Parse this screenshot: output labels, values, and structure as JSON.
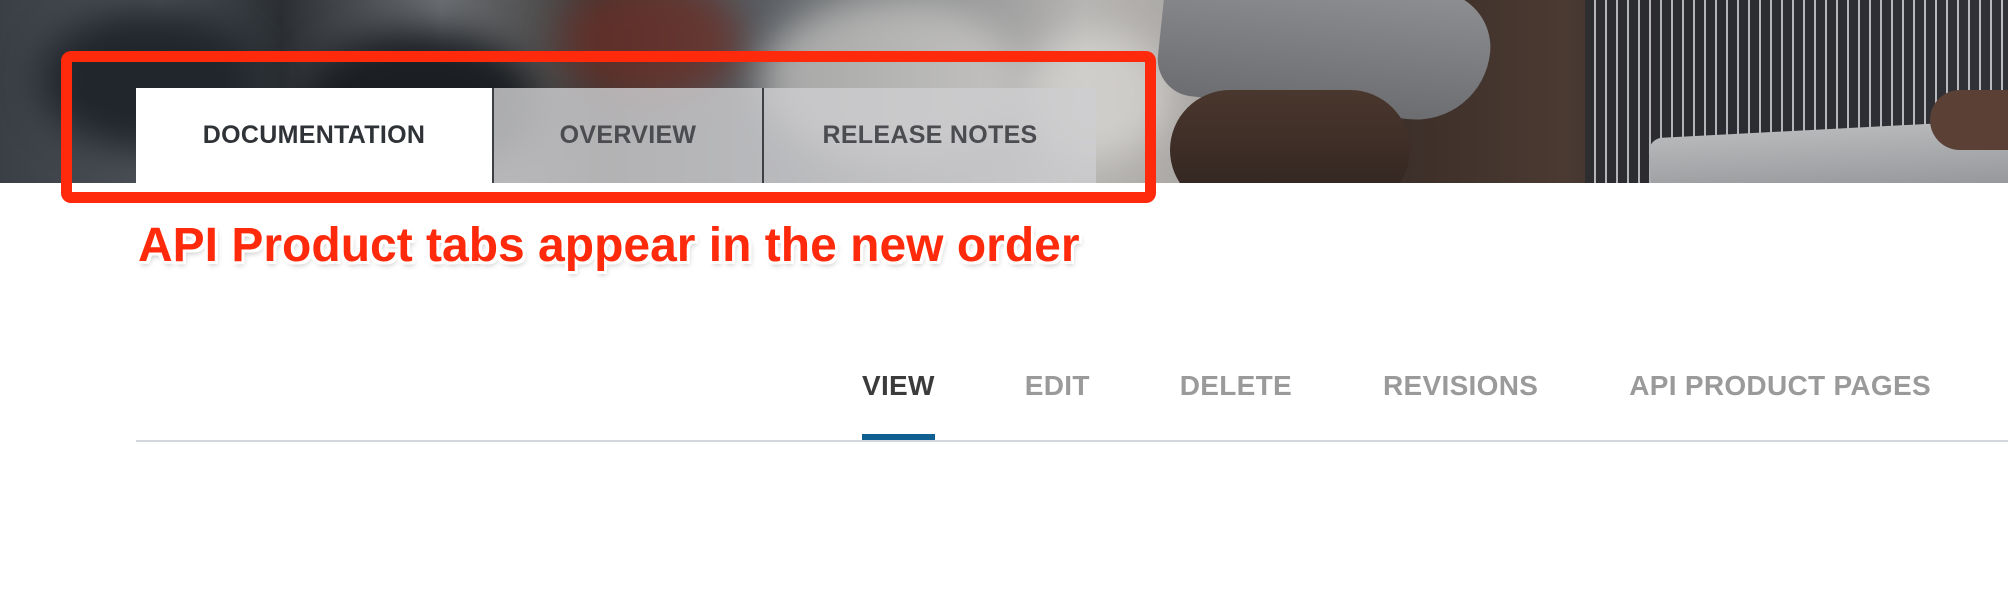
{
  "product_tabs": [
    {
      "label": "DOCUMENTATION",
      "active": true
    },
    {
      "label": "OVERVIEW",
      "active": false
    },
    {
      "label": "RELEASE NOTES",
      "active": false
    }
  ],
  "annotation": {
    "caption": "API Product tabs appear in the new order",
    "color": "#ff2a0c"
  },
  "admin_tabs": [
    {
      "label": "VIEW",
      "active": true
    },
    {
      "label": "EDIT",
      "active": false
    },
    {
      "label": "DELETE",
      "active": false
    },
    {
      "label": "REVISIONS",
      "active": false
    },
    {
      "label": "API PRODUCT PAGES",
      "active": false
    }
  ],
  "colors": {
    "active_underline": "#0f5f90",
    "inactive_text": "#9a9a9a",
    "active_text": "#3b3b3b"
  }
}
